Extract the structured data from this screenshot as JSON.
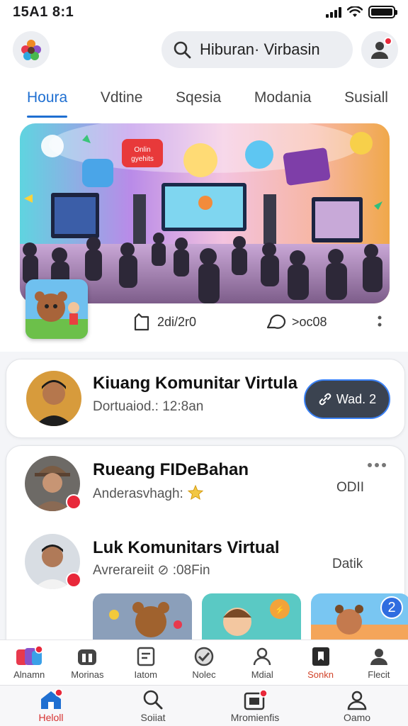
{
  "status_bar": {
    "time": "15A1 8:1"
  },
  "header": {
    "search": {
      "value": "Hiburan· Virbasin"
    }
  },
  "tabs": [
    {
      "label": "Houra",
      "active": true
    },
    {
      "label": "Vdtine",
      "active": false
    },
    {
      "label": "Sqesia",
      "active": false
    },
    {
      "label": "Modania",
      "active": false
    },
    {
      "label": "Susiall",
      "active": false
    }
  ],
  "hero": {
    "speech_bubble": "Onlin\ngyehits",
    "stat_posts": "2di/2r0",
    "stat_comments": ">oc08"
  },
  "cards": {
    "featured": {
      "title": "Kiuang Komunitar Virtula",
      "subtitle": "Dortuaiod.: 12:8an",
      "button_label": "Wad. 2"
    },
    "list": [
      {
        "title": "Rueang FIDeBahan",
        "subtitle": "Anderasvhagh: ",
        "side": "ODII"
      },
      {
        "title": "Luk Komunitars Virtual",
        "subtitle": "Avrerareiit ⊘ :08Fin",
        "side": "Datik"
      }
    ],
    "thumb_badge": "2"
  },
  "categories": [
    {
      "label": "Alnamn",
      "icon": "puzzle-icon"
    },
    {
      "label": "Morinas",
      "icon": "gamepad-icon"
    },
    {
      "label": "Iatom",
      "icon": "card-icon"
    },
    {
      "label": "Nolec",
      "icon": "no-sign-icon"
    },
    {
      "label": "Mdial",
      "icon": "person-icon"
    },
    {
      "label": "Sonkn",
      "icon": "photo-icon",
      "selected": true
    },
    {
      "label": "Flecit",
      "icon": "user-icon"
    }
  ],
  "nav": [
    {
      "label": "Heloll",
      "icon": "home-icon",
      "active": true
    },
    {
      "label": "Soiiat",
      "icon": "search-icon"
    },
    {
      "label": "Mromienfis",
      "icon": "inbox-icon"
    },
    {
      "label": "Oamo",
      "icon": "profile-icon"
    }
  ],
  "colors": {
    "accent": "#1f6fd1",
    "alert": "#e8283a",
    "button": "#3b4350"
  }
}
